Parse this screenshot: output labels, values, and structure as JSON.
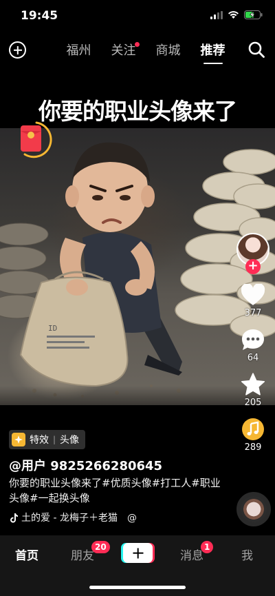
{
  "status_bar": {
    "time": "19:45"
  },
  "top_nav": {
    "tabs": [
      {
        "label": "福州",
        "active": false,
        "dot": false
      },
      {
        "label": "关注",
        "active": false,
        "dot": true
      },
      {
        "label": "商城",
        "active": false,
        "dot": false
      },
      {
        "label": "推荐",
        "active": true,
        "dot": false
      }
    ]
  },
  "video": {
    "headline": "你要的职业头像来了",
    "sack_print": "ID"
  },
  "rail": {
    "likes": "377",
    "comments": "64",
    "favorites": "205",
    "shares": "289",
    "follow_symbol": "+"
  },
  "info": {
    "effect_label": "特效",
    "effect_name": "头像",
    "username": "@用户 9825266280645",
    "description": "你要的职业头像来了#优质头像#打工人#职业头像#一起换头像",
    "music": "土的爱 - 龙梅子＋老猫　@"
  },
  "bottom_nav": {
    "home": "首页",
    "friends": "朋友",
    "friends_badge": "20",
    "messages": "消息",
    "messages_badge": "1",
    "me": "我"
  },
  "colors": {
    "accent": "#ff2c55",
    "gold": "#f6b733",
    "bar_bg": "#161616"
  }
}
